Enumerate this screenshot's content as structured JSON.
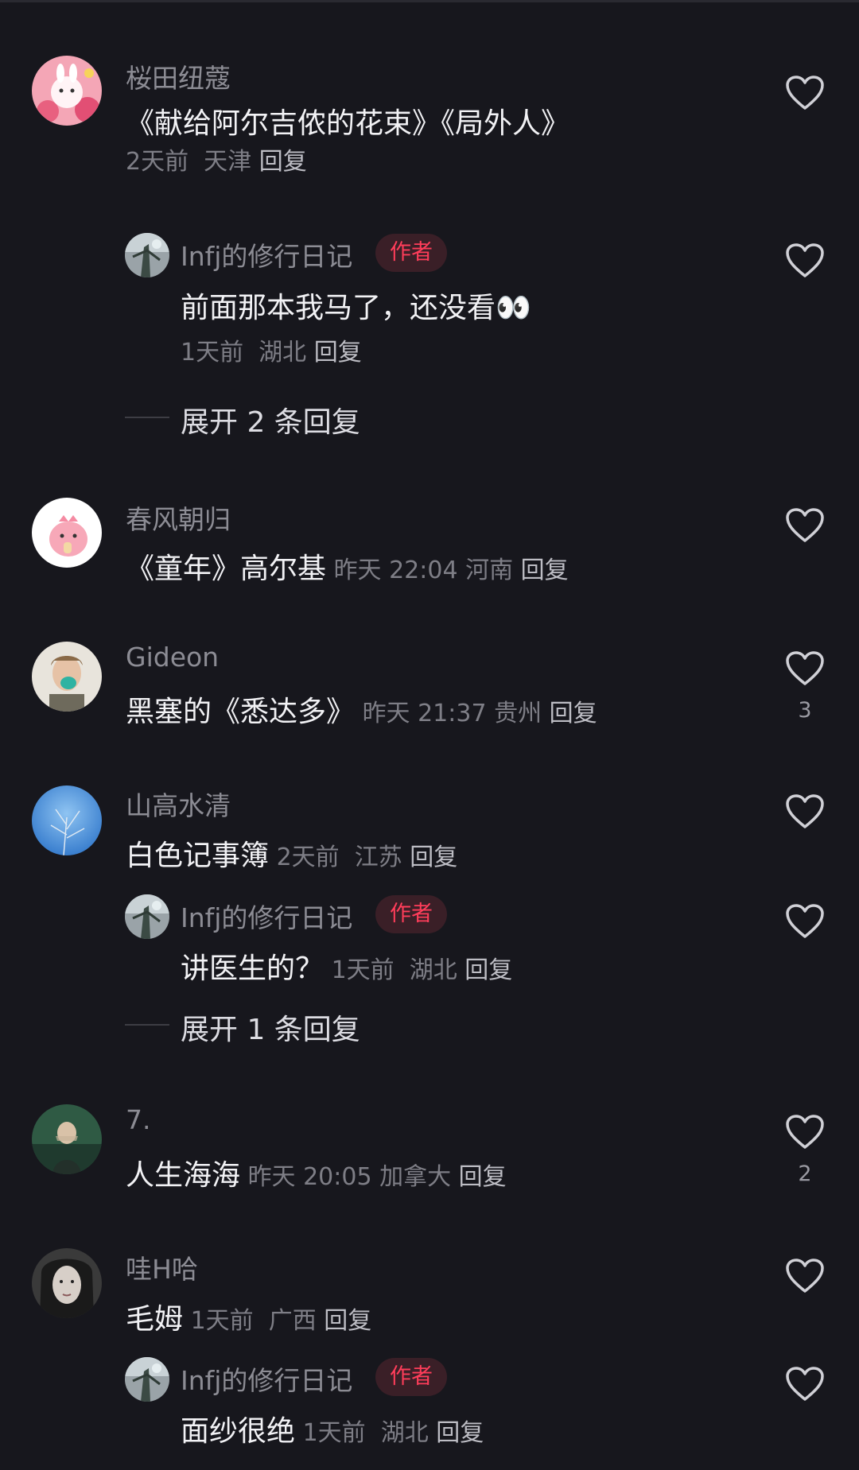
{
  "comments": [
    {
      "name": "桜田纽蔻",
      "text": "《献给阿尔吉侬的花束》《局外人》",
      "time": "2天前",
      "location": "天津",
      "reply_label": "回复",
      "likes": "",
      "replies": [
        {
          "name": "Infj的修行日记",
          "badge": "作者",
          "text": "前面那本我马了，还没看👀",
          "time": "1天前",
          "location": "湖北",
          "reply_label": "回复"
        }
      ],
      "expand_label": "展开 2 条回复"
    },
    {
      "name": "春风朝归",
      "text": "《童年》高尔基",
      "time": "昨天 22:04",
      "location": "河南",
      "reply_label": "回复",
      "likes": ""
    },
    {
      "name": "Gideon",
      "text": "黑塞的《悉达多》",
      "time": "昨天 21:37",
      "location": "贵州",
      "reply_label": "回复",
      "likes": "3"
    },
    {
      "name": "山高水清",
      "text": "白色记事簿",
      "time": "2天前",
      "location": "江苏",
      "reply_label": "回复",
      "likes": "",
      "replies": [
        {
          "name": "Infj的修行日记",
          "badge": "作者",
          "text": "讲医生的？",
          "time": "1天前",
          "location": "湖北",
          "reply_label": "回复"
        }
      ],
      "expand_label": "展开 1 条回复"
    },
    {
      "name": "7.",
      "text": "人生海海",
      "time": "昨天 20:05",
      "location": "加拿大",
      "reply_label": "回复",
      "likes": "2"
    },
    {
      "name": "哇H哈",
      "text": "毛姆",
      "time": "1天前",
      "location": "广西",
      "reply_label": "回复",
      "likes": "",
      "replies": [
        {
          "name": "Infj的修行日记",
          "badge": "作者",
          "text": "面纱很绝",
          "time": "1天前",
          "location": "湖北",
          "reply_label": "回复"
        }
      ]
    }
  ],
  "icons": {
    "like": "heart-outline-icon"
  },
  "colors": {
    "background": "#17171d",
    "author_badge": "#ff3d5a"
  }
}
